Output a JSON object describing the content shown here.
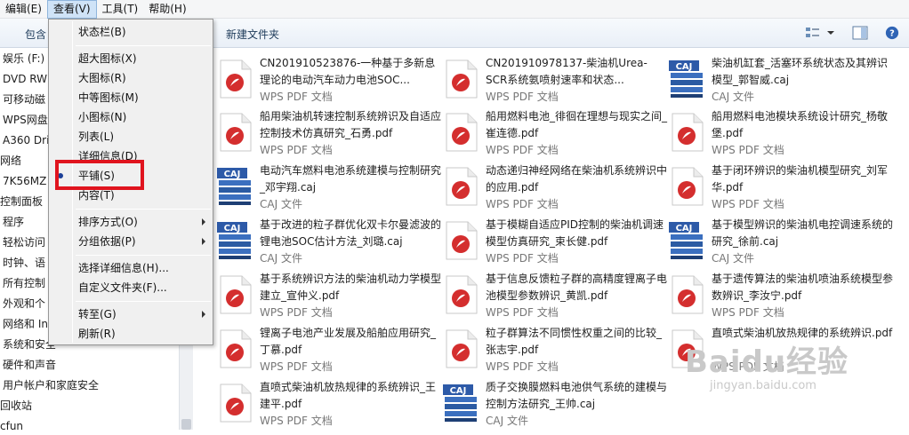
{
  "menubar": {
    "items": [
      "编辑(E)",
      "查看(V)",
      "工具(T)",
      "帮助(H)"
    ]
  },
  "toolbar": {
    "include_label": "包含",
    "new_folder": "新建文件夹"
  },
  "nav": {
    "items": [
      "娱乐 (F:)",
      "DVD RW",
      "可移动磁",
      "WPS网盘",
      "A360 Dri",
      "网络",
      "7K56MZ",
      "控制面板",
      "程序",
      "轻松访问",
      "时钟、语",
      "所有控制",
      "外观和个",
      "网络和 In",
      "系统和安全",
      "硬件和声音",
      "用户帐户和家庭安全",
      "回收站",
      "cfun"
    ]
  },
  "view_menu": {
    "items": [
      "状态栏(B)",
      "超大图标(X)",
      "大图标(R)",
      "中等图标(M)",
      "小图标(N)",
      "列表(L)",
      "详细信息(D)",
      "平铺(S)",
      "内容(T)",
      "排序方式(O)",
      "分组依据(P)",
      "选择详细信息(H)...",
      "自定义文件夹(F)...",
      "转至(G)",
      "刷新(R)"
    ],
    "selected": "平铺(S)"
  },
  "files": [
    {
      "name": "CN201910523876-一种基于多新息理论的电动汽车动力电池SOC...",
      "type": "WPS PDF 文档",
      "kind": "pdf"
    },
    {
      "name": "CN201910978137-柴油机Urea-SCR系统氨喷射速率和状态...",
      "type": "WPS PDF 文档",
      "kind": "pdf"
    },
    {
      "name": "柴油机缸套_活塞环系统状态及其辨识模型_郭智威.caj",
      "type": "CAJ 文件",
      "kind": "caj"
    },
    {
      "name": "船用柴油机转速控制系统辨识及自适应控制技术仿真研究_石勇.pdf",
      "type": "WPS PDF 文档",
      "kind": "pdf"
    },
    {
      "name": "船用燃料电池_徘徊在理想与现实之间_崔连德.pdf",
      "type": "WPS PDF 文档",
      "kind": "pdf"
    },
    {
      "name": "船用燃料电池模块系统设计研究_杨敬堡.pdf",
      "type": "WPS PDF 文档",
      "kind": "pdf"
    },
    {
      "name": "电动汽车燃料电池系统建模与控制研究_邓宇翔.caj",
      "type": "CAJ 文件",
      "kind": "caj"
    },
    {
      "name": "动态递归神经网络在柴油机系统辨识中的应用.pdf",
      "type": "WPS PDF 文档",
      "kind": "pdf"
    },
    {
      "name": "基于闭环辨识的柴油机模型研究_刘军华.pdf",
      "type": "WPS PDF 文档",
      "kind": "pdf"
    },
    {
      "name": "基于改进的粒子群优化双卡尔曼滤波的锂电池SOC估计方法_刘璐.caj",
      "type": "CAJ 文件",
      "kind": "caj"
    },
    {
      "name": "基于模糊自适应PID控制的柴油机调速模型仿真研究_束长健.pdf",
      "type": "WPS PDF 文档",
      "kind": "pdf"
    },
    {
      "name": "基于模型辨识的柴油机电控调速系统的研究_徐前.caj",
      "type": "CAJ 文件",
      "kind": "caj"
    },
    {
      "name": "基于系统辨识方法的柴油机动力学模型建立_宣仲义.pdf",
      "type": "WPS PDF 文档",
      "kind": "pdf"
    },
    {
      "name": "基于信息反馈粒子群的高精度锂离子电池模型参数辨识_黄凯.pdf",
      "type": "WPS PDF 文档",
      "kind": "pdf"
    },
    {
      "name": "基于遗传算法的柴油机喷油系统模型参数辨识_李汝宁.pdf",
      "type": "WPS PDF 文档",
      "kind": "pdf"
    },
    {
      "name": "锂离子电池产业发展及船舶应用研究_丁慕.pdf",
      "type": "WPS PDF 文档",
      "kind": "pdf"
    },
    {
      "name": "粒子群算法不同惯性权重之间的比较_张志宇.pdf",
      "type": "WPS PDF 文档",
      "kind": "pdf"
    },
    {
      "name": "直喷式柴油机放热规律的系统辨识.pdf",
      "type": "WPS PDF 文档",
      "kind": "pdf"
    },
    {
      "name": "直喷式柴油机放热规律的系统辨识_王建平.pdf",
      "type": "WPS PDF 文档",
      "kind": "pdf"
    },
    {
      "name": "质子交换膜燃料电池供气系统的建模与控制方法研究_王帅.caj",
      "type": "CAJ 文件",
      "kind": "caj"
    }
  ],
  "watermark": {
    "text": "Baidu经验",
    "url_text": "jingyan.baidu.com"
  },
  "colors": {
    "highlight_box": "#e0141e",
    "pdf_red": "#d42e2e",
    "caj_blue": "#2d5aa8"
  }
}
